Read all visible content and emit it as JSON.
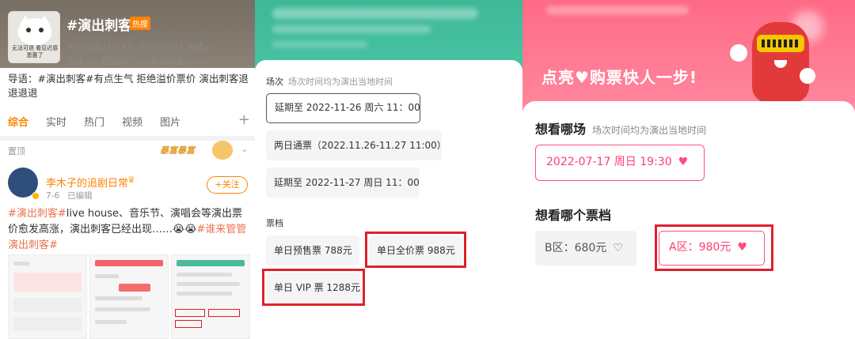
{
  "panel1": {
    "topic": "#演出刺客#",
    "hot_badge": "热搜",
    "cat_caption": "无法可退 看见迟感恩惠了",
    "stats": "今日阅读150.3万  今日讨论32  详情>",
    "host": "主持人：剧耀娱乐 | 1家媒体发布",
    "lead": "导语：#演出刺客#有点生气 拒绝溢价票价 演出刺客退退退退",
    "tabs": [
      "综合",
      "实时",
      "热门",
      "视频",
      "图片"
    ],
    "plus": "+",
    "pinned": "置顶",
    "sticker": "暴富暴富",
    "chevron": "⌄",
    "user_name": "李木子的追剧日常",
    "user_meta_date": "7-6",
    "user_meta_edit": "已编辑",
    "follow": "+关注",
    "post_part1": "#演出刺客#",
    "post_part2": "live house、音乐节、演唱会等演出票价愈发高涨，演出刺客已经出现……😭😭",
    "post_part3": "#谁来管管演出刺客#"
  },
  "panel2": {
    "session_title": "场次",
    "session_sub": "场次时间均为演出当地时间",
    "sessions": [
      "延期至 2022-11-26 周六 11：00",
      "两日通票（2022.11.26-11.27 11:00）",
      "延期至 2022-11-27 周日 11：00"
    ],
    "tier_title": "票档",
    "tiers": [
      "单日预售票 788元",
      "单日全价票 988元",
      "单日 VIP 票 1288元"
    ]
  },
  "panel3": {
    "slogan_a": "点亮",
    "slogan_heart": "♥",
    "slogan_b": "购票快人一步!",
    "show_title": "想看哪场",
    "show_sub": "场次时间均为演出当地时间",
    "date": "2022-07-17 周日 19:30",
    "heart": "♥",
    "tier_title": "想看哪个票档",
    "zone_b": "B区：680元",
    "zone_b_icon": "♡",
    "zone_a": "A区：980元",
    "zone_a_icon": "♥"
  },
  "colors": {
    "accent_orange": "#ff8200",
    "highlight_red": "#e0202a",
    "pink": "#ff4d7a",
    "teal": "#3fb897"
  }
}
